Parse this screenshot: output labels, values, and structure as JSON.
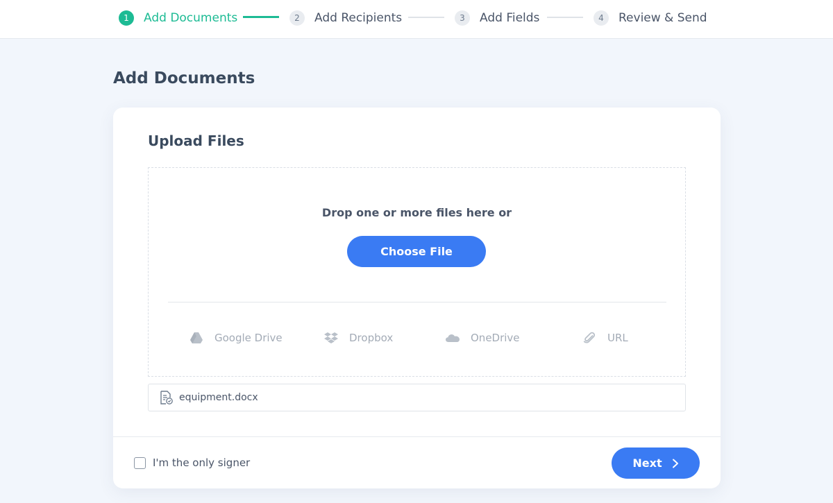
{
  "stepper": {
    "steps": [
      {
        "number": "1",
        "label": "Add Documents",
        "active": true
      },
      {
        "number": "2",
        "label": "Add Recipients",
        "active": false
      },
      {
        "number": "3",
        "label": "Add Fields",
        "active": false
      },
      {
        "number": "4",
        "label": "Review & Send",
        "active": false
      }
    ]
  },
  "page": {
    "title": "Add Documents"
  },
  "upload": {
    "title": "Upload Files",
    "drop_text": "Drop one or more files here or",
    "choose_label": "Choose File",
    "sources": [
      {
        "label": "Google Drive",
        "icon": "google-drive-icon"
      },
      {
        "label": "Dropbox",
        "icon": "dropbox-icon"
      },
      {
        "label": "OneDrive",
        "icon": "onedrive-icon"
      },
      {
        "label": "URL",
        "icon": "paperclip-icon"
      }
    ]
  },
  "files": [
    {
      "name": "equipment.docx",
      "icon": "document-icon"
    }
  ],
  "footer": {
    "only_signer_label": "I'm the only signer",
    "only_signer_checked": false,
    "next_label": "Next"
  },
  "colors": {
    "accent_green": "#1dbb94",
    "primary_blue": "#3a7bf3",
    "background": "#f2f6fc"
  }
}
